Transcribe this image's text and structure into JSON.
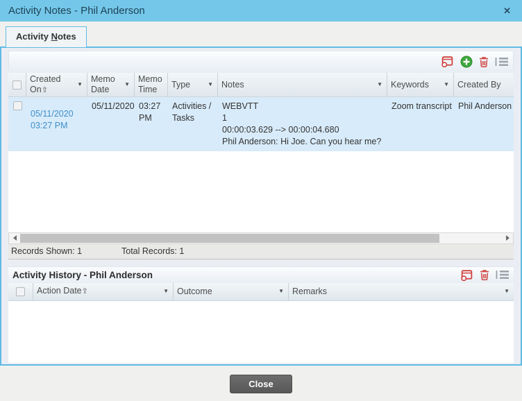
{
  "titlebar": {
    "title": "Activity Notes - Phil Anderson",
    "close_glyph": "✕"
  },
  "tab": {
    "pre": "Activity ",
    "accel": "N",
    "post": "otes"
  },
  "glyphs": {
    "filter": "▼",
    "sort_asc": "⇧"
  },
  "notes_table": {
    "columns": {
      "created_on": "Created On",
      "memo_date": "Memo Date",
      "memo_time": "Memo Time",
      "type": "Type",
      "notes": "Notes",
      "keywords": "Keywords",
      "created_by": "Created By"
    },
    "row": {
      "created_on": "05/11/2020 03:27 PM",
      "memo_date": "05/11/2020",
      "memo_time": "03:27 PM",
      "type": "Activities / Tasks",
      "notes_line1": "WEBVTT",
      "notes_line2": "1",
      "notes_line3": "00:00:03.629 --> 00:00:04.680",
      "notes_line4": "Phil Anderson: Hi Joe. Can you hear me?",
      "keywords": "Zoom transcript",
      "created_by": "Phil Anderson"
    },
    "status": {
      "records_shown": "Records Shown: 1",
      "total_records": "Total Records: 1"
    }
  },
  "history": {
    "title": "Activity History - Phil Anderson",
    "columns": {
      "action_date": "Action Date",
      "outcome": "Outcome",
      "remarks": "Remarks"
    }
  },
  "footer": {
    "close_label": "Close"
  }
}
